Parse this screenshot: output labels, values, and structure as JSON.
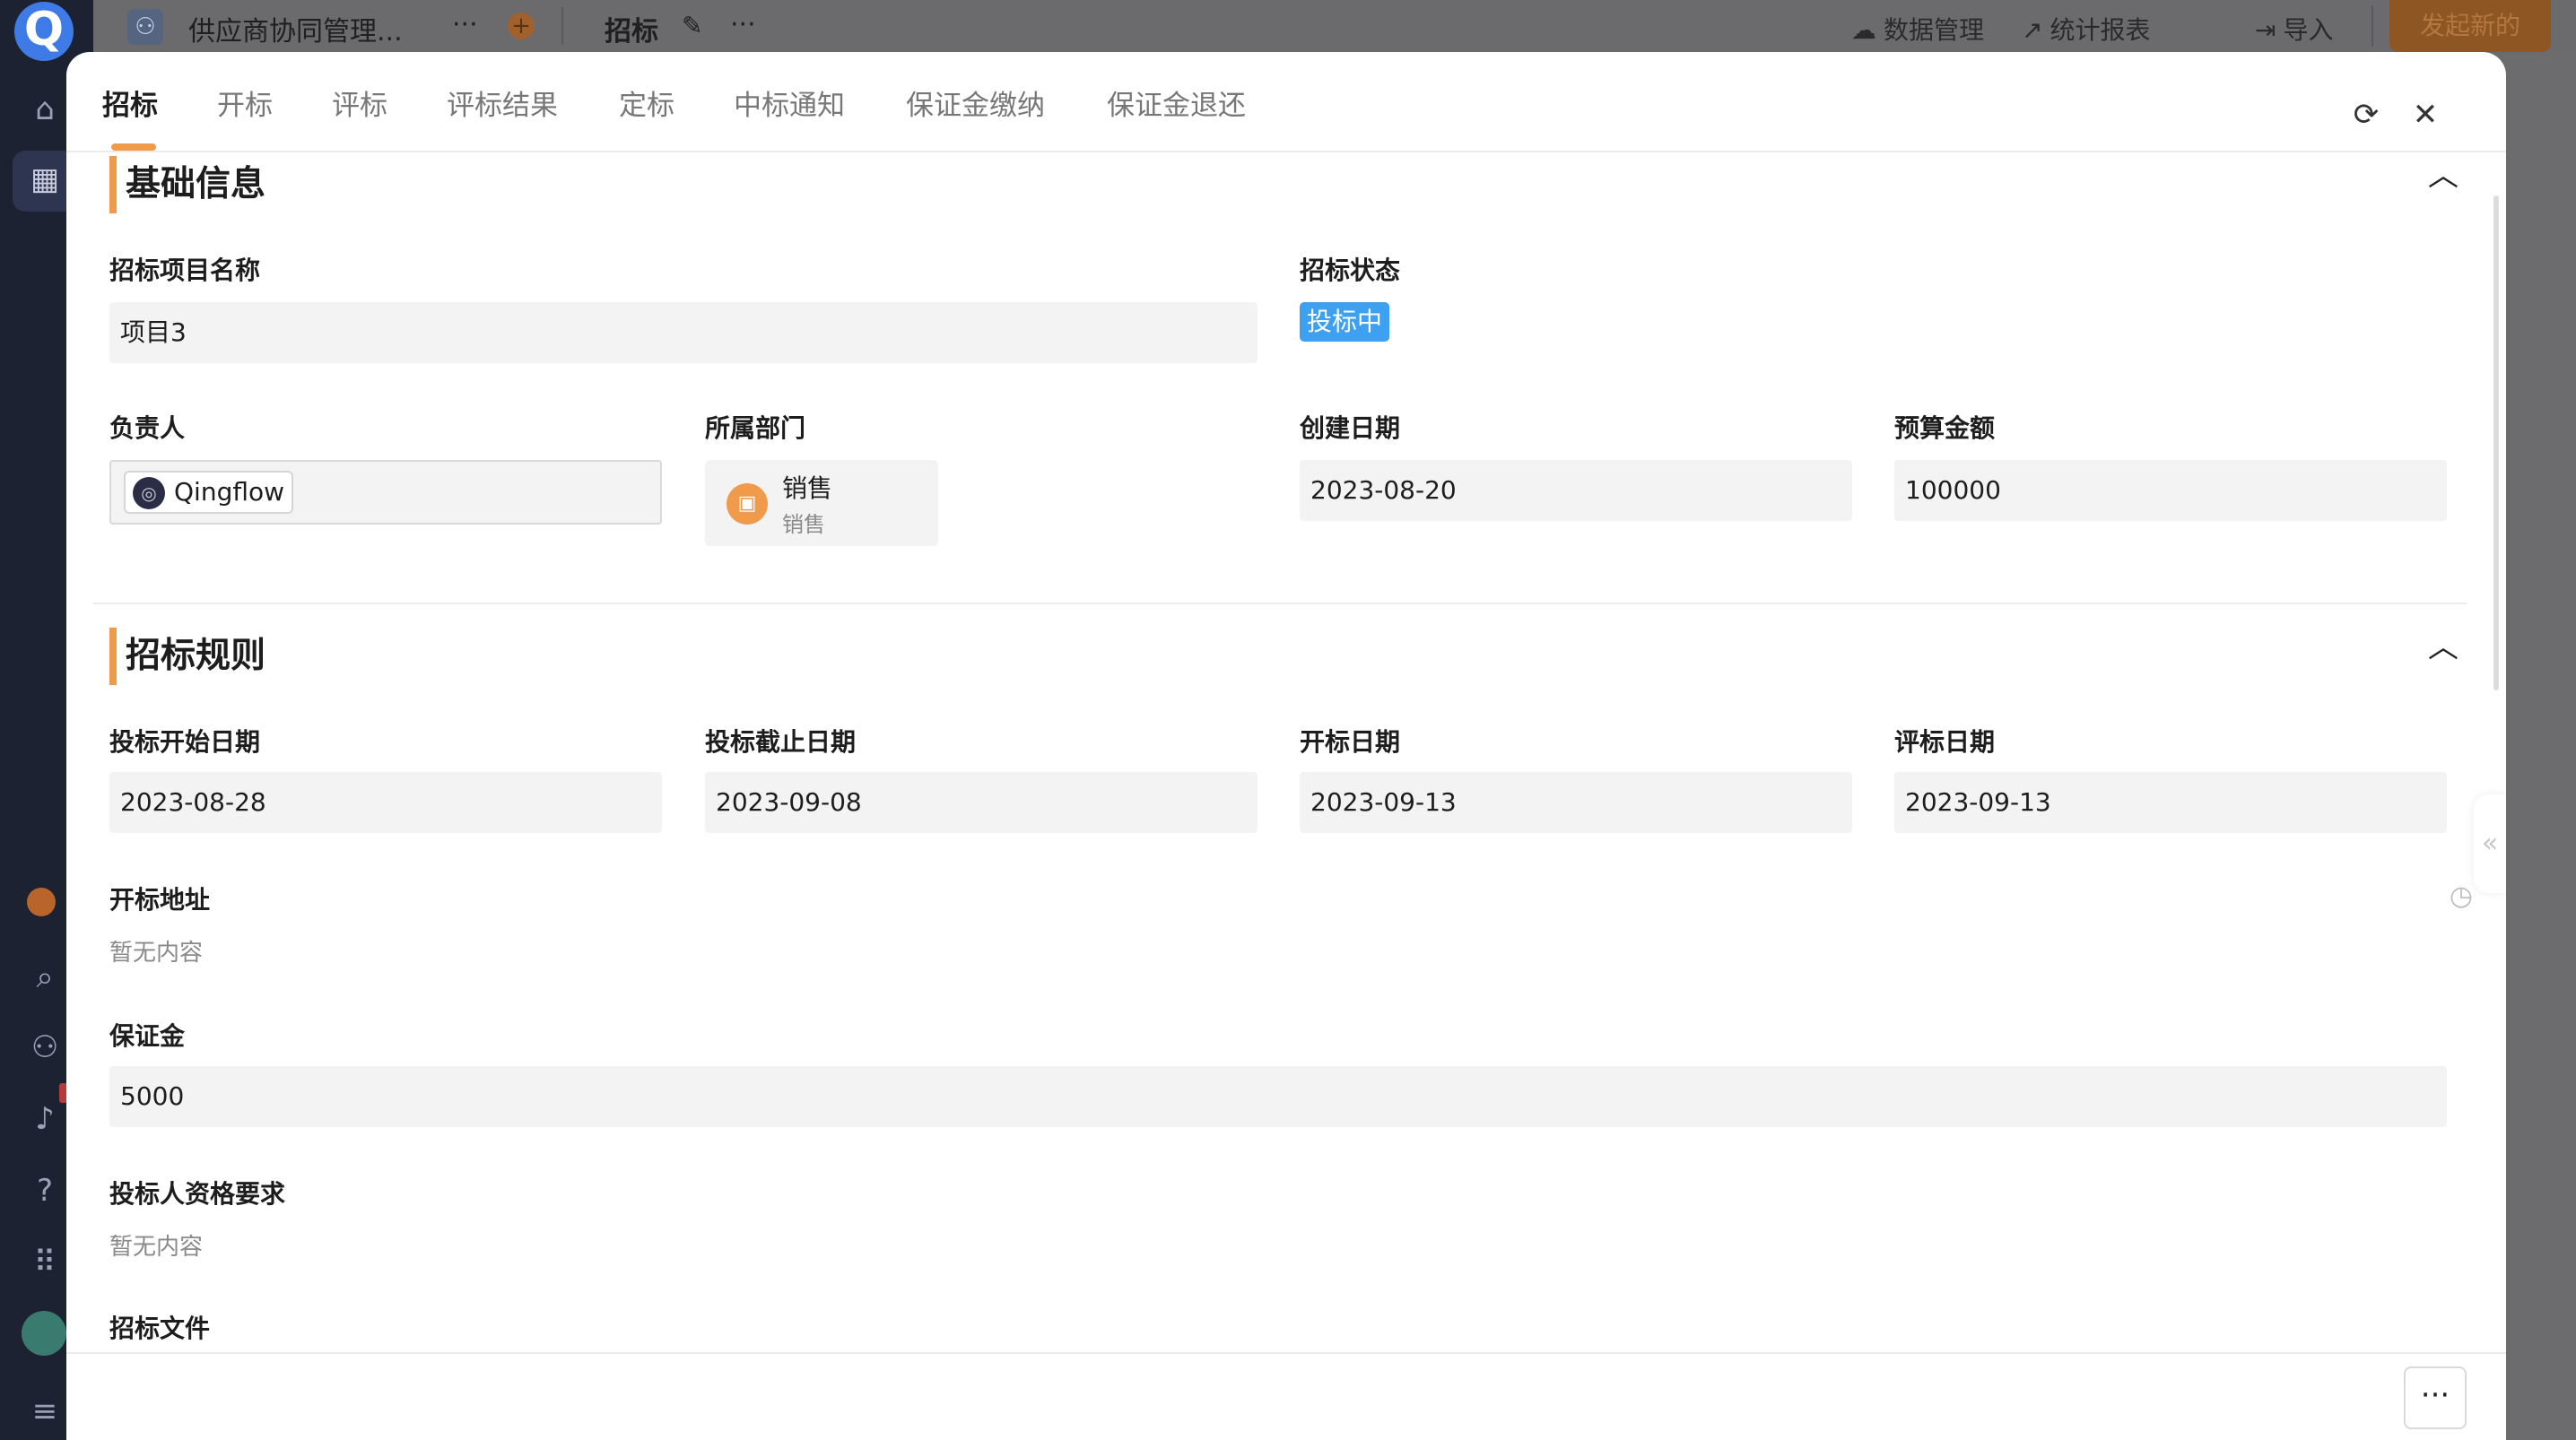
{
  "topbar": {
    "app_name": "供应商协同管理...",
    "more": "···",
    "plus": "+",
    "page_name": "招标",
    "data_mgmt": "数据管理",
    "stats": "统计报表",
    "import": "导入",
    "start_new": "发起新的"
  },
  "rail": {
    "logo": "Q"
  },
  "tabs": [
    "招标",
    "开标",
    "评标",
    "评标结果",
    "定标",
    "中标通知",
    "保证金缴纳",
    "保证金退还"
  ],
  "section_basic": {
    "title": "基础信息",
    "project_name_label": "招标项目名称",
    "project_name": "项目3",
    "status_label": "招标状态",
    "status": "投标中",
    "owner_label": "负责人",
    "owner": "Qingflow",
    "dept_label": "所属部门",
    "dept_name": "销售",
    "dept_sub": "销售",
    "created_label": "创建日期",
    "created": "2023-08-20",
    "budget_label": "预算金额",
    "budget": "100000"
  },
  "section_rules": {
    "title": "招标规则",
    "bid_start_label": "投标开始日期",
    "bid_start": "2023-08-28",
    "bid_end_label": "投标截止日期",
    "bid_end": "2023-09-08",
    "open_date_label": "开标日期",
    "open_date": "2023-09-13",
    "eval_date_label": "评标日期",
    "eval_date": "2023-09-13",
    "open_addr_label": "开标地址",
    "open_addr_empty": "暂无内容",
    "deposit_label": "保证金",
    "deposit": "5000",
    "qual_label": "投标人资格要求",
    "qual_empty": "暂无内容",
    "files_label": "招标文件"
  },
  "icons": {
    "refresh": "refresh-icon",
    "close": "close-icon",
    "collapse": "chevron-up-icon"
  },
  "colors": {
    "accent": "#f09a4c",
    "status_blue": "#3ea0f0",
    "rail": "#1d2233"
  }
}
